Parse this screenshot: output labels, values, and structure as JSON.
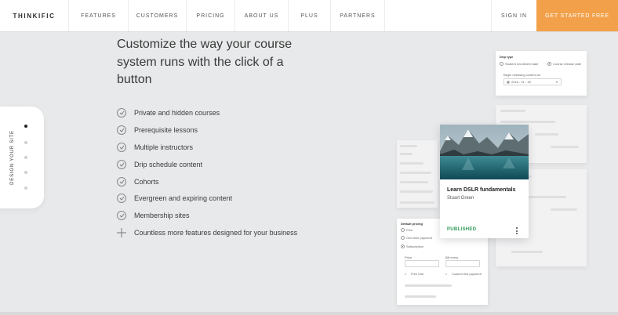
{
  "nav": {
    "logo": "THINKIFIC",
    "links": [
      "FEATURES",
      "CUSTOMERS",
      "PRICING",
      "ABOUT US",
      "PLUS",
      "PARTNERS"
    ],
    "sign_in": "SIGN IN",
    "cta": "GET STARTED FREE"
  },
  "side_tab": {
    "label": "DESIGN YOUR SITE",
    "dot_count": 5,
    "active_dot": 1
  },
  "hero": {
    "headline": "Customize the way your course system runs with the click of a button",
    "features": [
      "Private and hidden courses",
      "Prerequisite lessons",
      "Multiple instructors",
      "Drip schedule content",
      "Cohorts",
      "Evergreen and expiring content",
      "Membership sites"
    ],
    "more": "Countless more features designed for your business"
  },
  "drip_card": {
    "title": "Drip type",
    "option_1": "Student enrollment date",
    "option_2": "Course release date",
    "field_label": "Begin releasing content on",
    "date_value": "2018 - 01 - 30"
  },
  "pricing_card": {
    "title": "Default pricing",
    "option_1": "Free",
    "option_2": "One-time payment",
    "option_3": "Subscription",
    "price_label": "Price",
    "interval_label": "Bill every",
    "checkbox_1": "Free trial",
    "checkbox_2": "Custom first payment"
  },
  "course_card": {
    "title": "Learn DSLR fundamentals",
    "author": "Stuart Green",
    "status": "PUBLISHED"
  },
  "colors": {
    "cta": "#f2a14a",
    "published": "#2e9a56",
    "background": "#e8e9ea"
  }
}
